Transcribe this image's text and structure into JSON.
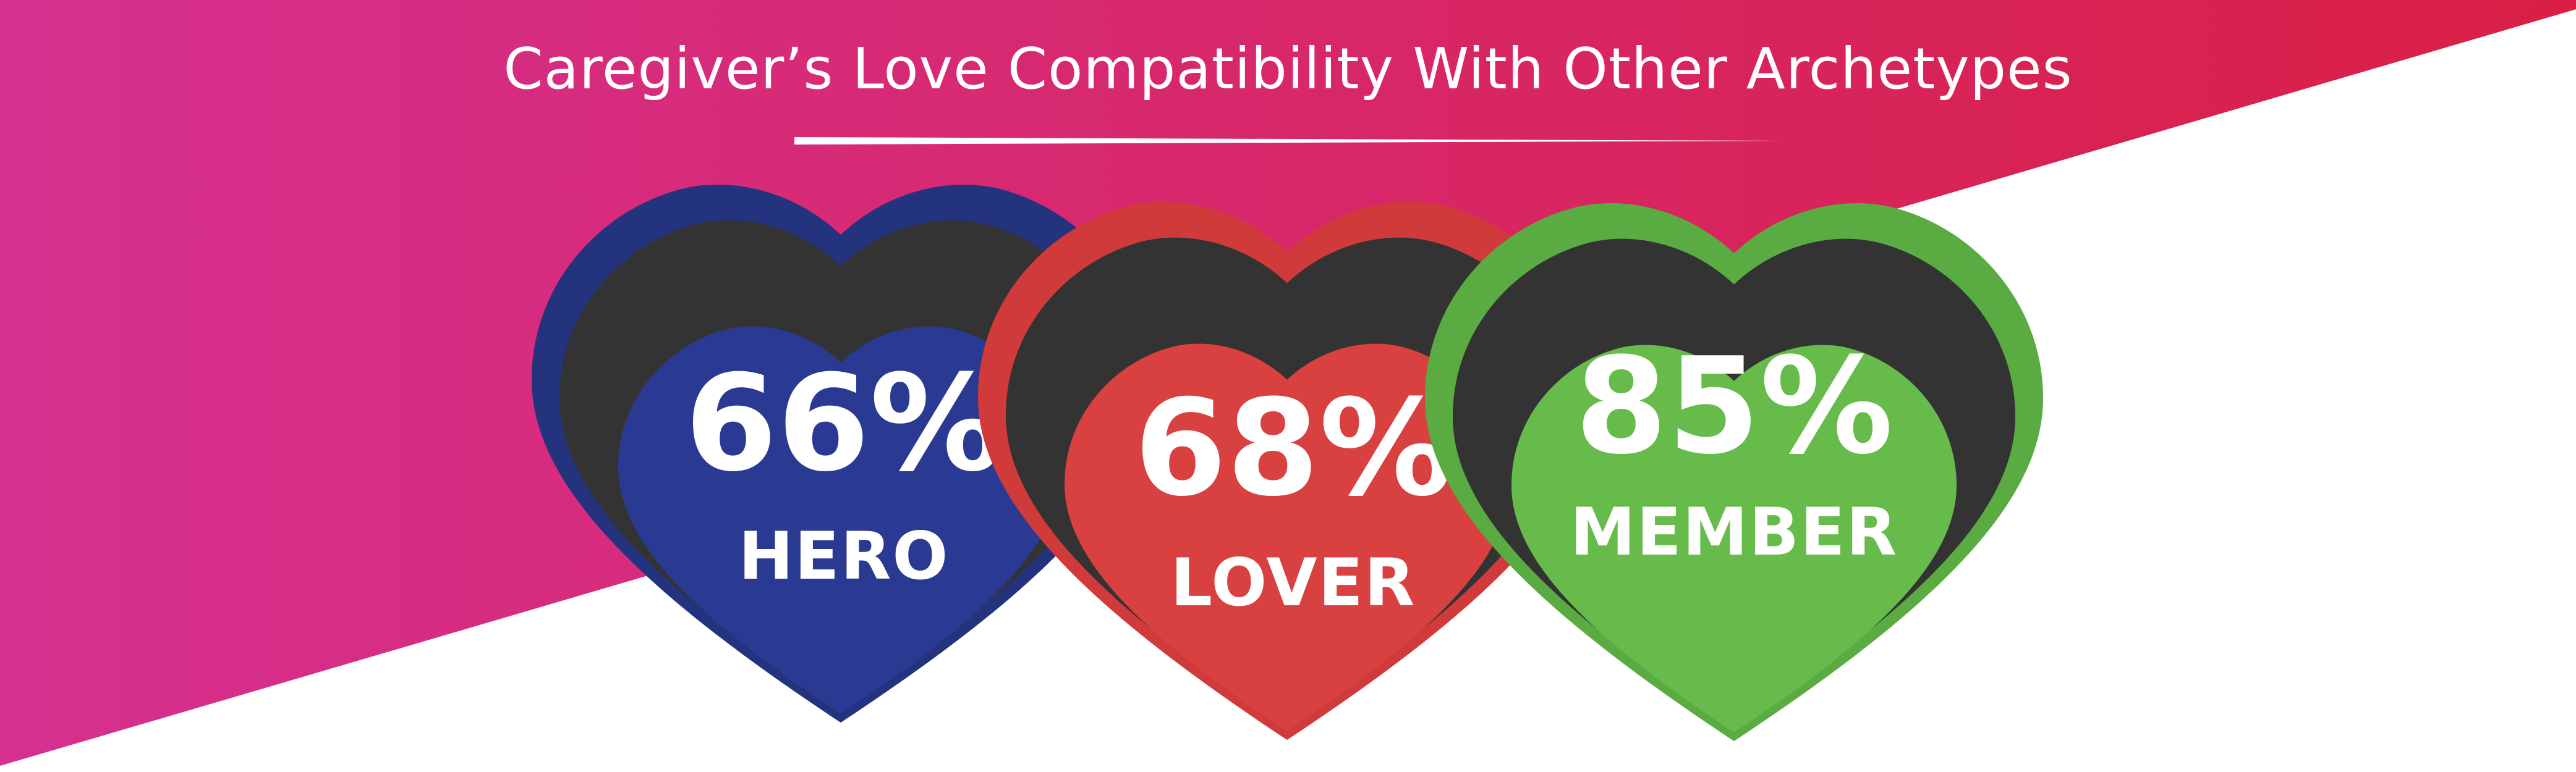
{
  "title": "Caregiver’s Love Compatibility With Other Archetypes",
  "colors": {
    "gradient_start": "#d6308f",
    "gradient_end": "#d91f45",
    "heart_inner": "#333333",
    "hero": "#2a3a92",
    "hero_rim": "#24337e",
    "lover": "#d94040",
    "lover_rim": "#d13a3a",
    "member": "#66bb4a",
    "member_rim": "#5aac42"
  },
  "hearts": [
    {
      "percent": "66%",
      "label": "HERO"
    },
    {
      "percent": "68%",
      "label": "LOVER"
    },
    {
      "percent": "85%",
      "label": "MEMBER"
    }
  ]
}
